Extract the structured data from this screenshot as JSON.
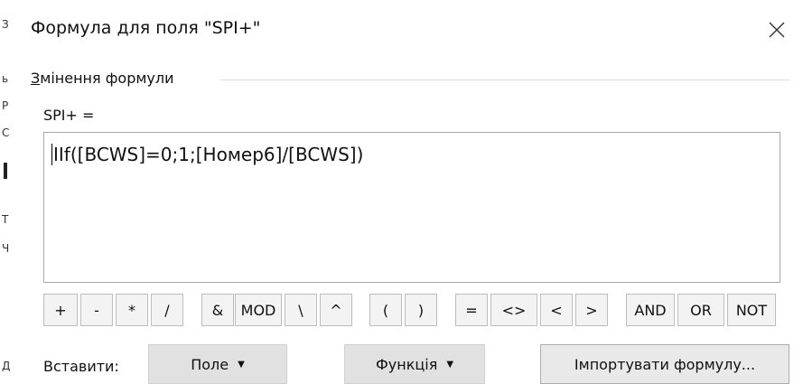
{
  "background_strip": {
    "glyphs": [
      "З",
      "ь",
      "Р",
      "С",
      "Т",
      "Ч",
      "Д"
    ]
  },
  "dialog": {
    "title": "Формула для поля \"SPI+\"",
    "group": {
      "accelerator": "З",
      "legend_rest": "мінення формули"
    },
    "field_label": "SPI+ =",
    "formula": "IIf([BCWS]=0;1;[Номер6]/[BCWS])",
    "operators": [
      "+",
      "-",
      "*",
      "/",
      "&",
      "MOD",
      "\\",
      "^",
      "(",
      ")",
      "=",
      "<>",
      "<",
      ">",
      "AND",
      "OR",
      "NOT"
    ],
    "insert_label": "Вставити:",
    "field_button": "Поле",
    "function_button": "Функція",
    "import_button": "Імпортувати формулу..."
  },
  "colors": {
    "button_bg": "#f3f3f3",
    "button_border": "#bdbdbd",
    "dropdown_bg": "#e1e1e1"
  }
}
